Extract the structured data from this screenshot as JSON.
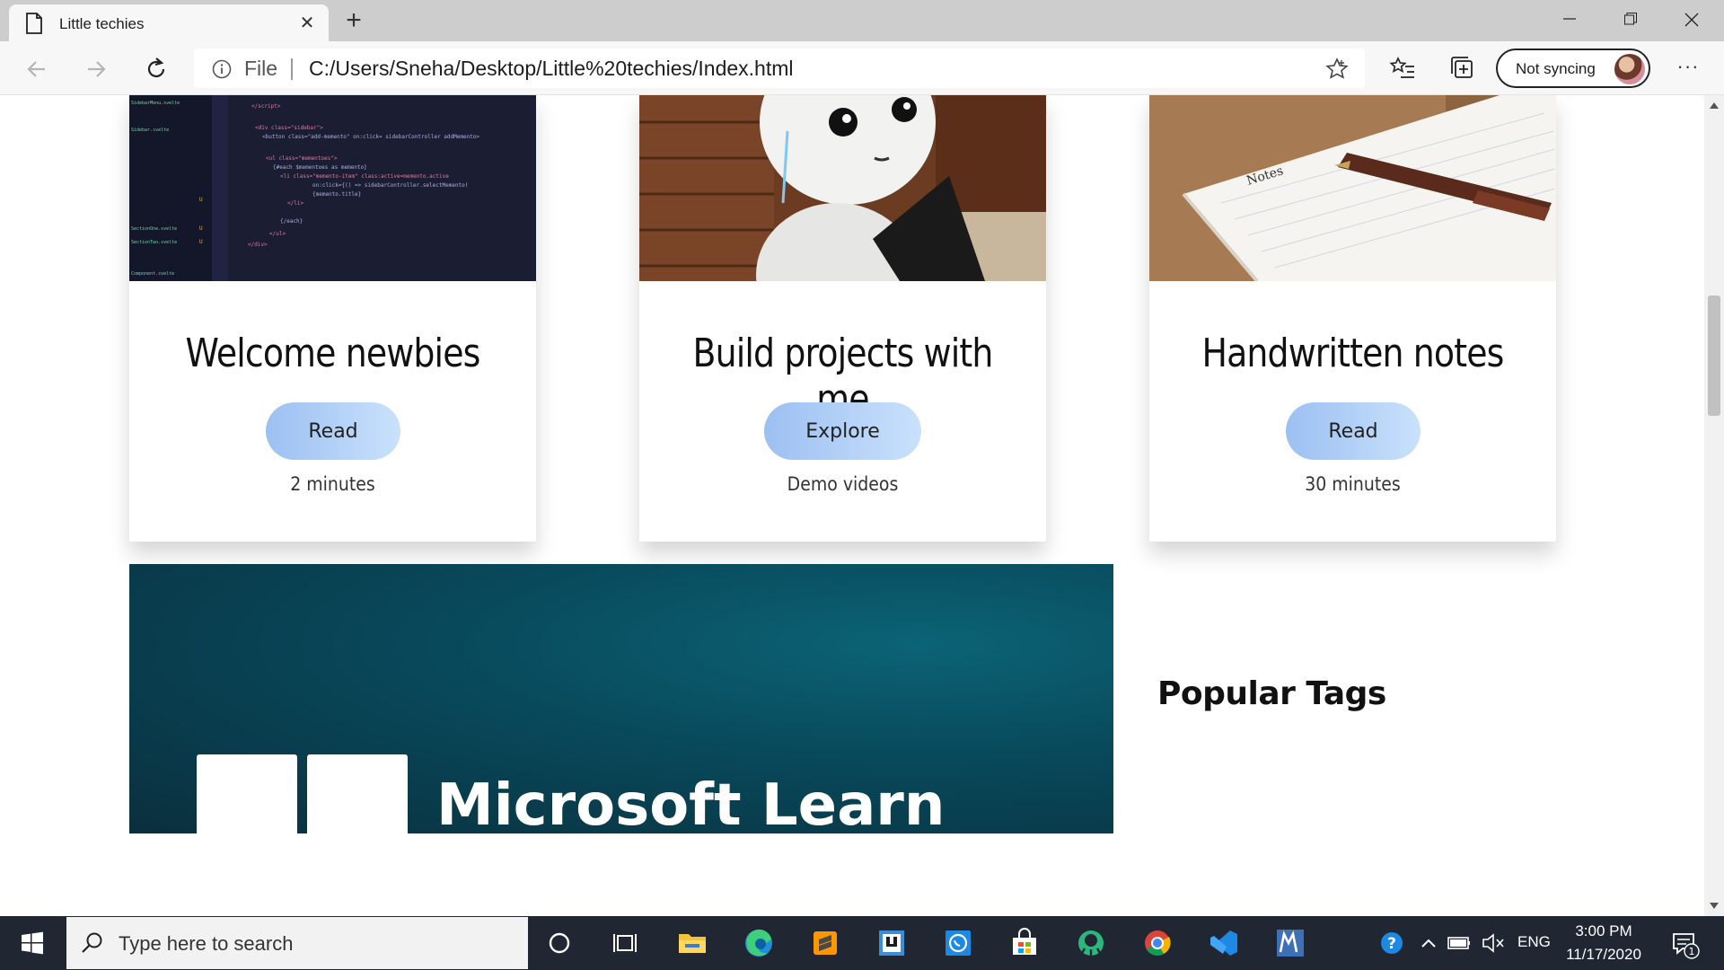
{
  "browser": {
    "tab_title": "Little techies",
    "address": {
      "scheme_label": "File",
      "url": "C:/Users/Sneha/Desktop/Little%20techies/Index.html"
    },
    "profile_label": "Not syncing",
    "menu_label": "···"
  },
  "cards": [
    {
      "title": "Welcome newbies",
      "button": "Read",
      "meta": "2 minutes",
      "image": "code-editor-photo"
    },
    {
      "title": "Build projects with me",
      "button": "Explore",
      "meta": "Demo videos",
      "image": "robot-photo"
    },
    {
      "title": "Handwritten notes",
      "button": "Read",
      "meta": "30 minutes",
      "image": "notebook-pen-photo"
    }
  ],
  "banner": {
    "text": "Microsoft Learn"
  },
  "sidebar": {
    "tags_title": "Popular Tags"
  },
  "taskbar": {
    "search_placeholder": "Type here to search",
    "language": "ENG",
    "time": "3:00 PM",
    "date": "11/17/2020",
    "notification_count": "1"
  },
  "colors": {
    "button_gradient_start": "#9cc0f2",
    "button_gradient_end": "#c9e1fb",
    "taskbar": "#202733",
    "banner": "#08485a"
  }
}
